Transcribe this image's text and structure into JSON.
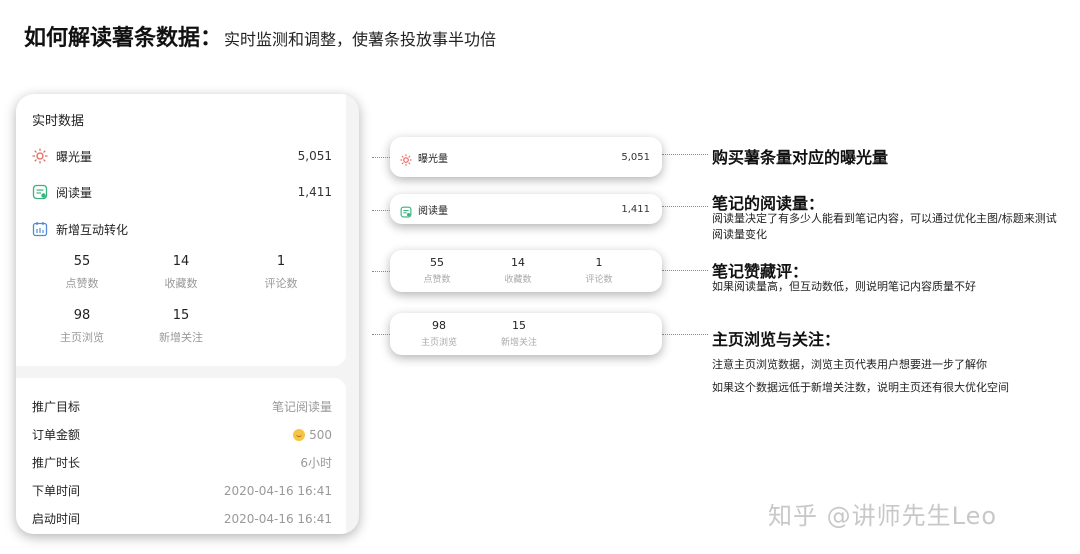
{
  "header": {
    "title_bold": "如何解读薯条数据：",
    "title_normal": "实时监测和调整，使薯条投放事半功倍"
  },
  "panel": {
    "title": "实时数据",
    "exposure": {
      "label": "曝光量",
      "value": "5,051",
      "icon": "sun-icon",
      "color": "#e4655a"
    },
    "reads": {
      "label": "阅读量",
      "value": "1,411",
      "icon": "document-icon",
      "color": "#37b37e"
    },
    "interaction": {
      "label": "新增互动转化",
      "icon": "calendar-icon",
      "color": "#4f8bd6"
    },
    "stats": [
      {
        "value": "55",
        "label": "点赞数"
      },
      {
        "value": "14",
        "label": "收藏数"
      },
      {
        "value": "1",
        "label": "评论数"
      },
      {
        "value": "98",
        "label": "主页浏览"
      },
      {
        "value": "15",
        "label": "新增关注"
      }
    ],
    "info": [
      {
        "key": "推广目标",
        "value": "笔记阅读量"
      },
      {
        "key": "订单金额",
        "value": "500"
      },
      {
        "key": "推广时长",
        "value": "6小时"
      },
      {
        "key": "下单时间",
        "value": "2020-04-16 16:41"
      },
      {
        "key": "启动时间",
        "value": "2020-04-16 16:41"
      }
    ]
  },
  "annotations": [
    {
      "title": "购买薯条量对应的曝光量"
    },
    {
      "title": "笔记的阅读量：",
      "desc": "阅读量决定了有多少人能看到笔记内容，可以通过优化主图/标题来测试阅读量变化"
    },
    {
      "title": "笔记赞藏评：",
      "desc": "如果阅读量高，但互动数低，则说明笔记内容质量不好"
    },
    {
      "title": "主页浏览与关注：",
      "desc1": "注意主页浏览数据，浏览主页代表用户想要进一步了解你",
      "desc2": "如果这个数据远低于新增关注数，说明主页还有很大优化空间"
    }
  ],
  "watermark": "知乎 @讲师先生Leo"
}
